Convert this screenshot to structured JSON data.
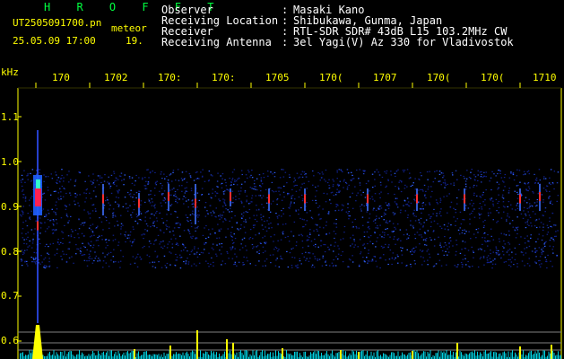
{
  "app": {
    "title": "H R O F F T",
    "filename": "UT2505091700.pn",
    "type": "meteor",
    "datetime": "25.05.09 17:00",
    "count": "19."
  },
  "info": [
    {
      "label": "Observer",
      "sep": ":",
      "value": "Masaki Kano"
    },
    {
      "label": "Receiving Location",
      "sep": ":",
      "value": "Shibukawa, Gunma, Japan"
    },
    {
      "label": "Receiver",
      "sep": ":",
      "value": "RTL-SDR SDR# 43dB L15 103.2MHz CW"
    },
    {
      "label": "Receiving Antenna",
      "sep": ":",
      "value": "3el Yagi(V) Az 330 for Vladivostok"
    }
  ],
  "axes": {
    "y_unit": "kHz",
    "y_ticks": [
      "1.1",
      "1.0",
      "0.9",
      "0.8",
      "0.7",
      "0.6"
    ],
    "x_ticks": [
      "170",
      "1702",
      "170:",
      "170:",
      "1705",
      "170(",
      "1707",
      "170(",
      "170(",
      "1710"
    ]
  },
  "colors": {
    "header_text": "#ffffff",
    "title": "#00ff40",
    "axis": "#ffff00",
    "background": "#000000"
  }
}
